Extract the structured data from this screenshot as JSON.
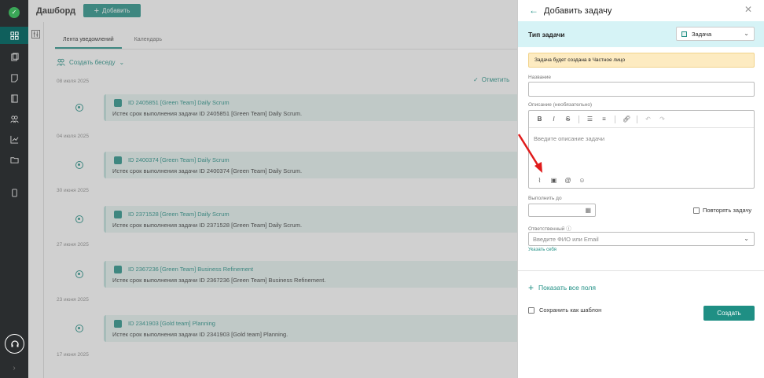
{
  "sidebar": {
    "accent": "#0f5f5c",
    "bg": "#2a2d2f",
    "items": [
      {
        "icon": "dashboard-icon"
      },
      {
        "icon": "clipboard-icon"
      },
      {
        "icon": "note-icon"
      },
      {
        "icon": "book-icon"
      },
      {
        "icon": "people-icon"
      },
      {
        "icon": "chart-icon"
      },
      {
        "icon": "folder-icon"
      },
      {
        "icon": "mobile-icon"
      }
    ]
  },
  "header": {
    "title": "Дашборд",
    "add_label": "Добавить"
  },
  "feed": {
    "tabs": [
      "Лента уведомлений",
      "Календарь"
    ],
    "create_conversation": "Создать беседу",
    "mark_read": "Отметить",
    "groups": [
      {
        "date": "08 июля 2025",
        "title": "ID 2405851 [Green Team] Daily Scrum",
        "text": "Истек срок выполнения задачи ID 2405851 [Green Team] Daily Scrum."
      },
      {
        "date": "04 июля 2025",
        "title": "ID 2400374 [Green Team] Daily Scrum",
        "text": "Истек срок выполнения задачи ID 2400374 [Green Team] Daily Scrum."
      },
      {
        "date": "30 июня 2025",
        "title": "ID 2371528 [Green Team] Daily Scrum",
        "text": "Истек срок выполнения задачи ID 2371528 [Green Team] Daily Scrum."
      },
      {
        "date": "27 июня 2025",
        "title": "ID 2367236 [Green Team] Business Refinement",
        "text": "Истек срок выполнения задачи ID 2367236 [Green Team] Business Refinement."
      },
      {
        "date": "23 июня 2025",
        "title": "ID 2341903 [Gold team] Planning",
        "text": "Истек срок выполнения задачи ID 2341903 [Gold team] Planning."
      }
    ],
    "last_date": "17 июня 2025"
  },
  "panel": {
    "title": "Добавить задачу",
    "type_label": "Тип задачи",
    "type_value": "Задача",
    "warning": "Задача будет создана в Частное лицо",
    "name_label": "Название",
    "description_label": "Описание (необязательно)",
    "description_placeholder": "Введите описание задачи",
    "toolbar": {
      "bold": "B",
      "italic": "I",
      "strike": "S"
    },
    "deadline_label": "Выполнить до",
    "repeat_label": "Повторять задачу",
    "responsible_label": "Ответственный",
    "responsible_placeholder": "Введите ФИО или Email",
    "assign_self": "Указать себя",
    "show_all": "Показать все поля",
    "save_template": "Сохранить как шаблон",
    "create": "Создать"
  },
  "colors": {
    "primary": "#1f8f84",
    "type_row_bg": "#d6f3f6",
    "warning_bg": "#fdebc1",
    "arrow": "#e01b1b"
  }
}
